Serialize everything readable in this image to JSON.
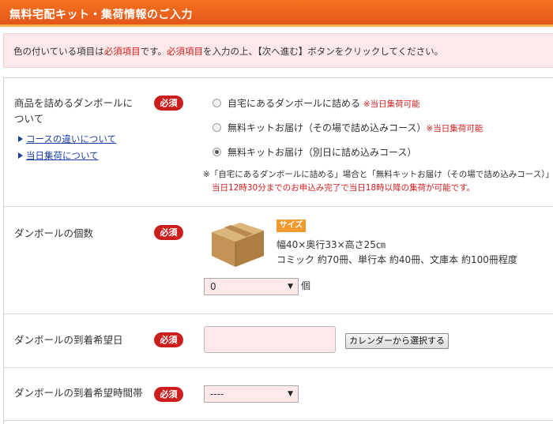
{
  "header": {
    "title": "無料宅配キット・集荷情報のご入力"
  },
  "notice": {
    "part1": "色の付いている項目は",
    "part2": "必須項目",
    "part3": "です。",
    "part4": "必須項目",
    "part5": "を入力の上、【次へ進む】ボタンをクリックしてください。"
  },
  "required_badge": "必須",
  "row_box": {
    "label_line1": "商品を詰めるダンボールに",
    "label_line2": "ついて",
    "links": [
      "コースの違いについて",
      "当日集荷について"
    ],
    "options": [
      {
        "label": "自宅にあるダンボールに詰める",
        "note": "※当日集荷可能",
        "checked": false
      },
      {
        "label": "無料キットお届け（その場で詰め込みコース）",
        "note": "※当日集荷可能",
        "checked": false
      },
      {
        "label": "無料キットお届け（別日に詰め込みコース）",
        "note": "",
        "checked": true
      }
    ],
    "footnote_line1": "※「自宅にあるダンボールに詰める」場合と「無料キットお届け（その場で詰め込みコース）」",
    "footnote_line2": "当日12時30分までのお申込み完了で当日18時以降の集荷が可能です。"
  },
  "row_count": {
    "label": "ダンボールの個数",
    "size_tag": "サイズ",
    "dimensions": "幅40×奥行33×高さ25㎝",
    "capacity": "コミック 約70冊、単行本 約40冊、文庫本 約100冊程度",
    "select_value": "0",
    "unit": "個"
  },
  "row_date": {
    "label": "ダンボールの到着希望日",
    "input_value": "",
    "calendar_button": "カレンダーから選択する"
  },
  "row_time": {
    "label": "ダンボールの到着希望時間帯",
    "select_value": "----"
  },
  "colors": {
    "header": "#e9601c",
    "required": "#cc1d1d",
    "notice_bg": "#fde9ea",
    "link": "#1a3fa0",
    "size_tag": "#f39a2e"
  }
}
